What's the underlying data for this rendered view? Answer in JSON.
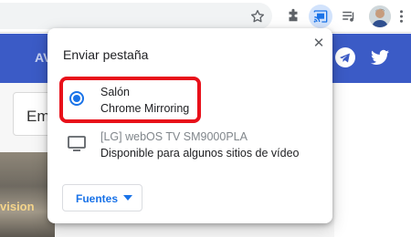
{
  "page": {
    "bar_text": "AV",
    "search_text": "Em",
    "thumb_text": "vision"
  },
  "icons": {
    "star": "star-icon",
    "extensions": "puzzle-icon",
    "cast": "cast-icon",
    "queue": "media-queue-icon",
    "menu": "kebab-menu-icon",
    "telegram": "telegram-icon",
    "twitter": "twitter-icon"
  },
  "dialog": {
    "title": "Enviar pestaña",
    "close_glyph": "✕",
    "sinks": [
      {
        "name": "Salón",
        "status": "Chrome Mirroring",
        "selected": true
      },
      {
        "name": "[LG] webOS TV SM9000PLA",
        "status": "Disponible para algunos sitios de vídeo",
        "selected": false
      }
    ],
    "sources_label": "Fuentes"
  },
  "colors": {
    "accent": "#1a73e8",
    "highlight": "#e8101a",
    "page_bar": "#3b5bc6"
  }
}
